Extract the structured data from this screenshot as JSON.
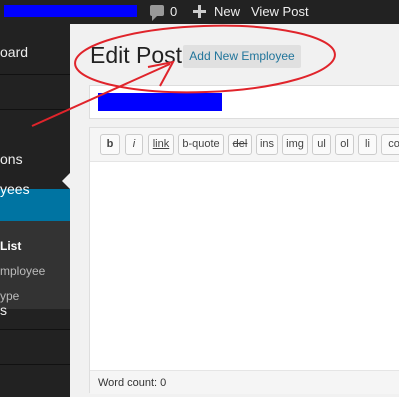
{
  "adminbar": {
    "comments_count": "0",
    "new_label": "New",
    "view_post_label": "View Post"
  },
  "sidebar": {
    "items": [
      {
        "label": "oard"
      },
      {
        "label": "ons"
      },
      {
        "label": "yees"
      },
      {
        "label": "s"
      }
    ],
    "submenu": [
      {
        "label": "List"
      },
      {
        "label": "mployee"
      },
      {
        "label": "ype"
      }
    ]
  },
  "page": {
    "title": "Edit Post",
    "add_new_label": "Add New Employee"
  },
  "editor": {
    "toolbar": [
      "b",
      "i",
      "link",
      "b-quote",
      "del",
      "ins",
      "img",
      "ul",
      "ol",
      "li",
      "co"
    ],
    "word_count_label": "Word count: 0"
  },
  "colors": {
    "annotation": "#e0242b",
    "admin_bar": "#222222",
    "active_menu": "#0074a2",
    "link": "#21759b",
    "redaction": "#0000ff"
  },
  "icons": {
    "comment": "speech-bubble",
    "new": "plus",
    "current_menu": "arrow-pointer"
  }
}
